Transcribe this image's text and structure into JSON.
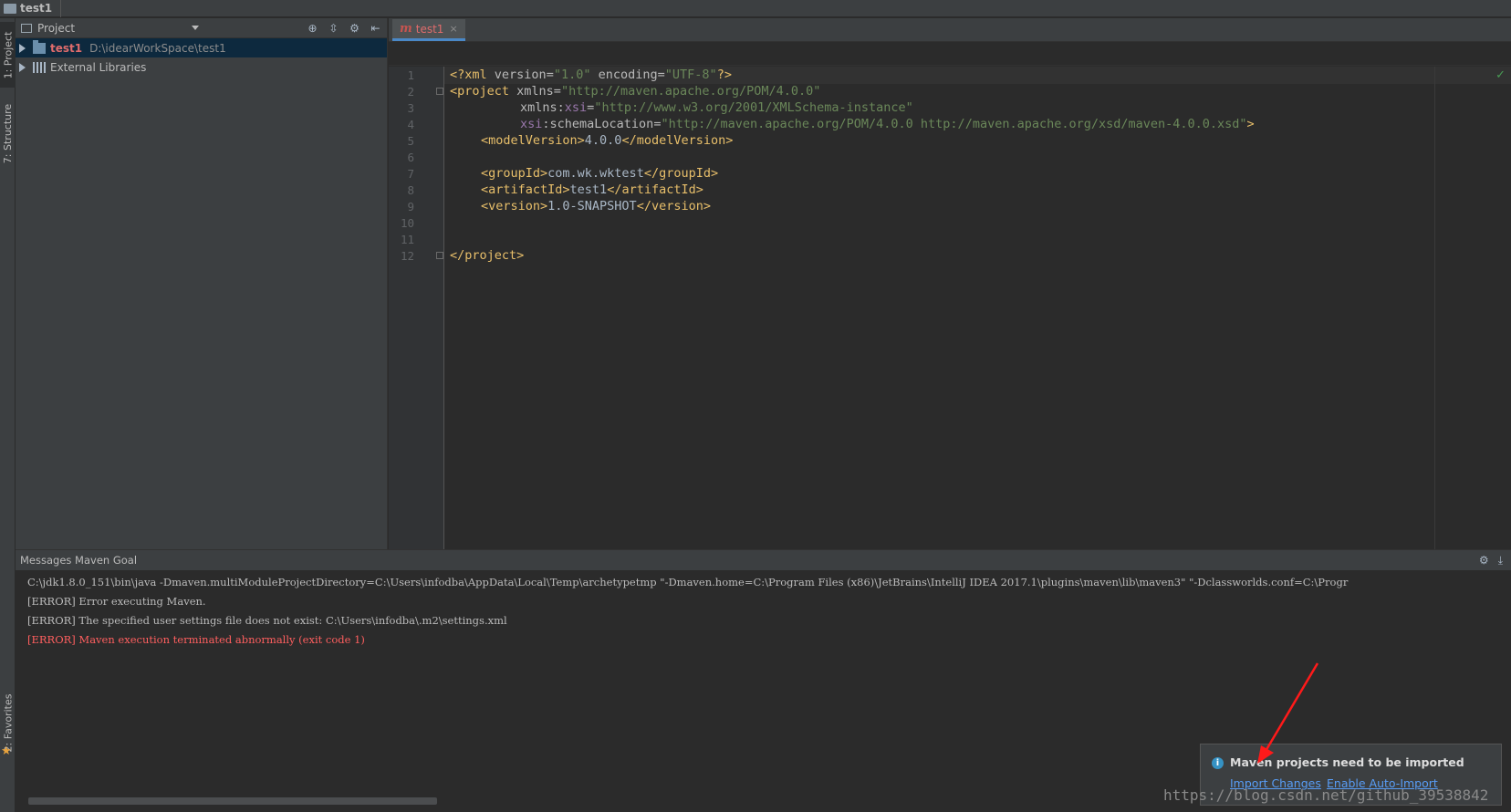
{
  "nav": {
    "crumb": "test1"
  },
  "left_strip": {
    "tabs": [
      "1: Project",
      "7: Structure",
      "2: Favorites"
    ]
  },
  "project_panel": {
    "title": "Project",
    "tree": [
      {
        "name": "test1",
        "path": "D:\\idearWorkSpace\\test1"
      },
      {
        "name": "External Libraries"
      }
    ]
  },
  "editor": {
    "tab_label": "test1",
    "tab_close": "×",
    "line_numbers": [
      "1",
      "2",
      "3",
      "4",
      "5",
      "6",
      "7",
      "8",
      "9",
      "10",
      "11",
      "12"
    ],
    "lines": {
      "l1": {
        "a": "<?xml ",
        "b": "version",
        "c": "=",
        "d": "\"1.0\"",
        "e": " ",
        "f": "encoding",
        "g": "=",
        "h": "\"UTF-8\"",
        "i": "?>"
      },
      "l2": {
        "a": "<project ",
        "b": "xmlns",
        "c": "=",
        "d": "\"http://maven.apache.org/POM/4.0.0\""
      },
      "l3": {
        "a": "xmlns",
        "b": ":",
        "c": "xsi",
        "d": "=",
        "e": "\"http://www.w3.org/2001/XMLSchema-instance\""
      },
      "l4": {
        "a": "xsi",
        "b": ":schemaLocation",
        "c": "=",
        "d": "\"http://maven.apache.org/POM/4.0.0 http://maven.apache.org/xsd/maven-4.0.0.xsd\"",
        "e": ">"
      },
      "l5": {
        "a": "<modelVersion>",
        "b": "4.0.0",
        "c": "</modelVersion>"
      },
      "l7": {
        "a": "<groupId>",
        "b": "com.wk.wktest",
        "c": "</groupId>"
      },
      "l8": {
        "a": "<artifactId>",
        "b": "test1",
        "c": "</artifactId>"
      },
      "l9": {
        "a": "<version>",
        "b": "1.0-SNAPSHOT",
        "c": "</version>"
      },
      "l12": {
        "a": "</project>"
      }
    },
    "status_check": "✓"
  },
  "messages": {
    "title": "Messages Maven Goal",
    "lines": [
      "C:\\jdk1.8.0_151\\bin\\java -Dmaven.multiModuleProjectDirectory=C:\\Users\\infodba\\AppData\\Local\\Temp\\archetypetmp \"-Dmaven.home=C:\\Program Files (x86)\\JetBrains\\IntelliJ IDEA 2017.1\\plugins\\maven\\lib\\maven3\" \"-Dclassworlds.conf=C:\\Progr",
      "[ERROR] Error executing Maven.",
      "[ERROR] The specified user settings file does not exist: C:\\Users\\infodba\\.m2\\settings.xml",
      "[ERROR] Maven execution terminated abnormally (exit code 1)"
    ]
  },
  "notification": {
    "icon": "i",
    "title": "Maven projects need to be imported",
    "link_import": "Import Changes",
    "link_auto": "Enable Auto-Import"
  },
  "watermark": "https://blog.csdn.net/github_39538842",
  "colors": {
    "accent": "#4a88c7",
    "error": "#ff5f5f",
    "annotation_arrow": "#ff1a1a"
  }
}
